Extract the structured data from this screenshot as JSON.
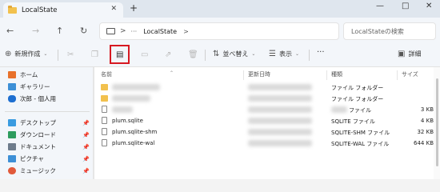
{
  "window": {
    "tab_title": "LocalState",
    "close_tab": "✕",
    "new_tab": "+",
    "minimize": "—",
    "maximize": "□",
    "close": "✕"
  },
  "address": {
    "separator": ">",
    "dots": "···",
    "path": "LocalState",
    "chevron": ">",
    "search_placeholder": "LocalStateの検索"
  },
  "toolbar": {
    "new_label": "新規作成",
    "sort_label": "並べ替え",
    "view_label": "表示",
    "more": "···",
    "details_label": "詳細"
  },
  "sidebar": {
    "items": [
      {
        "label": "ホーム",
        "color": "#e8712b"
      },
      {
        "label": "ギャラリー",
        "color": "#3d8fd6"
      },
      {
        "label": "次郎 - 個人用",
        "color": "#1e6fd0"
      },
      {
        "label": "デスクトップ",
        "color": "#3a9be0"
      },
      {
        "label": "ダウンロード",
        "color": "#2e9c5e"
      },
      {
        "label": "ドキュメント",
        "color": "#6d7b8b"
      },
      {
        "label": "ピクチャ",
        "color": "#3d8fd6"
      },
      {
        "label": "ミュージック",
        "color": "#e15a3b"
      }
    ]
  },
  "columns": {
    "name": "名前",
    "modified": "更新日時",
    "type": "種類",
    "size": "サイズ"
  },
  "files": [
    {
      "name": "",
      "type": "ファイル フォルダー",
      "size": "",
      "kind": "folder",
      "hidden": true
    },
    {
      "name": "",
      "type": "ファイル フォルダー",
      "size": "",
      "kind": "folder",
      "hidden": true
    },
    {
      "name": "",
      "type": "ファイル",
      "size": "3 KB",
      "kind": "file",
      "hidden": true
    },
    {
      "name": "plum.sqlite",
      "type": "SQLITE ファイル",
      "size": "4 KB",
      "kind": "file",
      "hidden": false
    },
    {
      "name": "plum.sqlite-shm",
      "type": "SQLITE-SHM ファイル",
      "size": "32 KB",
      "kind": "file",
      "hidden": false
    },
    {
      "name": "plum.sqlite-wal",
      "type": "SQLITE-WAL ファイル",
      "size": "644 KB",
      "kind": "file",
      "hidden": false
    }
  ],
  "colors": {
    "highlight_box": "#d71921",
    "folder": "#f2c14e"
  }
}
